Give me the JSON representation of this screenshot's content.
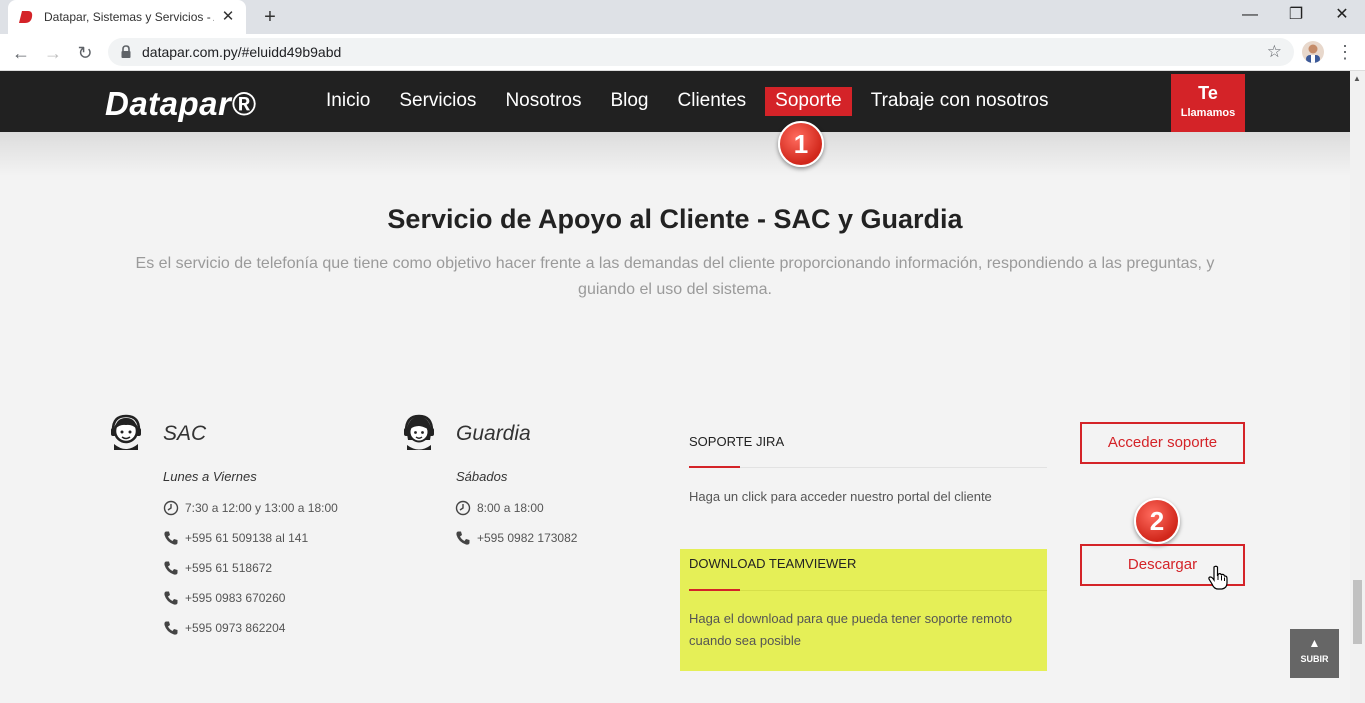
{
  "browser": {
    "tab_title": "Datapar, Sistemas y Servicios - A",
    "tab_close": "✕",
    "new_tab": "+",
    "url": "datapar.com.py/#eluidd49b9abd",
    "window_controls": {
      "minimize": "—",
      "maximize": "❐",
      "close": "✕"
    }
  },
  "site": {
    "logo": "Datapar®",
    "menu": [
      "Inicio",
      "Servicios",
      "Nosotros",
      "Blog",
      "Clientes",
      "Soporte",
      "Trabaje con nosotros"
    ],
    "active_menu": "Soporte",
    "cta_top": "Te",
    "cta_bottom": "Llamamos"
  },
  "annotations": {
    "step1": "1",
    "step2": "2"
  },
  "section": {
    "title": "Servicio de Apoyo al Cliente - SAC y Guardia",
    "description": "Es el servicio de telefonía que tiene como objetivo hacer frente a las demandas del cliente proporcionando información, respondiendo a las preguntas, y guiando el uso del sistema."
  },
  "sac": {
    "title": "SAC",
    "days": "Lunes a Viernes",
    "hours": "7:30 a 12:00 y 13:00 a 18:00",
    "phones": [
      "+595 61 509138 al 141",
      "+595 61 518672",
      "+595 0983 670260",
      "+595 0973 862204"
    ]
  },
  "guardia": {
    "title": "Guardia",
    "days": "Sábados",
    "hours": "8:00 a 18:00",
    "phones": [
      "+595 0982 173082"
    ]
  },
  "jira": {
    "title": "SOPORTE JIRA",
    "text": "Haga un click para acceder nuestro portal del cliente",
    "button": "Acceder soporte"
  },
  "teamviewer": {
    "title": "DOWNLOAD TEAMVIEWER",
    "text_line1": "Haga el download para que pueda tener soporte remoto",
    "text_line2": "cuando sea posible",
    "button": "Descargar"
  },
  "scroll_top": {
    "arrow": "▲",
    "label": "SUBIR"
  },
  "colors": {
    "brand_red": "#d42328",
    "navbar": "#212121",
    "highlight": "#e5ef57"
  }
}
